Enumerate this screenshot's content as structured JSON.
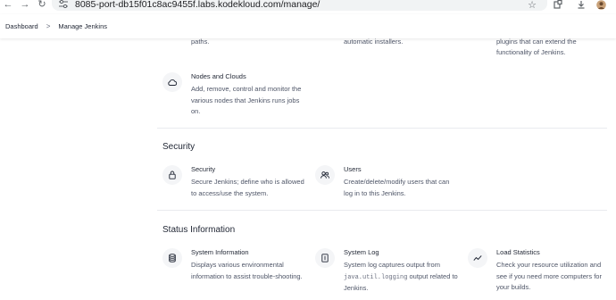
{
  "browser": {
    "url": "8085-port-db15f01c8ac9455f.labs.kodekloud.com/manage/"
  },
  "breadcrumb": {
    "items": [
      "Dashboard",
      "Manage Jenkins"
    ],
    "separator": ">"
  },
  "top_fragments": {
    "col1": "paths.",
    "col2": "automatic installers.",
    "col3_line1": "plugins that can extend the",
    "col3_line2": "functionality of Jenkins."
  },
  "system_configuration": {
    "nodes": {
      "title": "Nodes and Clouds",
      "description": "Add, remove, control and monitor the various nodes that Jenkins runs jobs on.",
      "icon": "cloud-icon"
    }
  },
  "security": {
    "title": "Security",
    "items": [
      {
        "title": "Security",
        "description": "Secure Jenkins; define who is allowed to access/use the system.",
        "icon": "lock-icon"
      },
      {
        "title": "Users",
        "description": "Create/delete/modify users that can log in to this Jenkins.",
        "icon": "users-icon"
      }
    ]
  },
  "status_information": {
    "title": "Status Information",
    "items": [
      {
        "title": "System Information",
        "description": "Displays various environmental information to assist trouble-shooting.",
        "icon": "database-icon"
      },
      {
        "title": "System Log",
        "description_pre": "System log captures output from",
        "description_code": "java.util.logging",
        "description_post": "output related to Jenkins.",
        "icon": "log-icon"
      },
      {
        "title": "Load Statistics",
        "description": "Check your resource utilization and see if you need more computers for your builds.",
        "icon": "chart-line-icon"
      }
    ]
  }
}
